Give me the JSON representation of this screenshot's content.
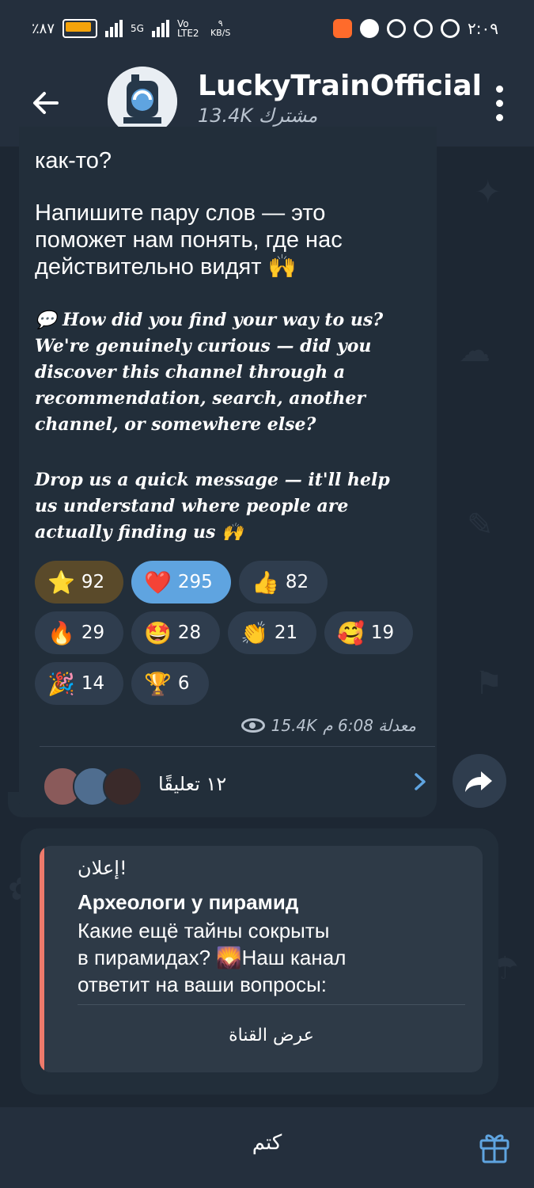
{
  "status_bar": {
    "battery": "٪٨٧",
    "network": "5G",
    "volte": "Vo LTE2",
    "speed_value": "٩",
    "speed_unit": "KB/S",
    "time": "٢:٠٩"
  },
  "header": {
    "title": "LuckyTrainOfficial",
    "subscribers": "13.4K مشترك"
  },
  "post": {
    "text_top": "как-то?",
    "text_ru": "Напишите пару слов — это\nпоможет нам понять, где нас\nдействительно видят 🙌",
    "text_en_q": "💬 How did you find your way to us?\nWe're genuinely curious — did you\ndiscover this channel through a\nrecommendation, search, another\nchannel, or somewhere else?",
    "text_en_drop": "Drop us a quick message — it'll help\nus understand where people are\nactually finding us 🙌",
    "reactions": [
      {
        "emoji": "⭐",
        "count": "92"
      },
      {
        "emoji": "❤️",
        "count": "295"
      },
      {
        "emoji": "👍",
        "count": "82"
      },
      {
        "emoji": "🔥",
        "count": "29"
      },
      {
        "emoji": "🤩",
        "count": "28"
      },
      {
        "emoji": "👏",
        "count": "21"
      },
      {
        "emoji": "🥰",
        "count": "19"
      },
      {
        "emoji": "🎉",
        "count": "14"
      },
      {
        "emoji": "🏆",
        "count": "6"
      }
    ],
    "meta": "معدلة 6:08 م",
    "views": "15.4K",
    "comments_label": "١٢ تعليقًا"
  },
  "ad": {
    "label": "إعلان!",
    "title": "Археологи у пирамид",
    "body": "Какие ещё тайны сокрыты\nв пирамидах? 🌄Наш канал\nответит на ваши вопросы:",
    "button": "عرض القناة"
  },
  "bottom": {
    "mute": "كتم"
  },
  "colors": {
    "background": "#1d2733",
    "bubble": "#222e3a",
    "accent": "#5fa4e0",
    "ad_bar": "#ee7a6b"
  }
}
